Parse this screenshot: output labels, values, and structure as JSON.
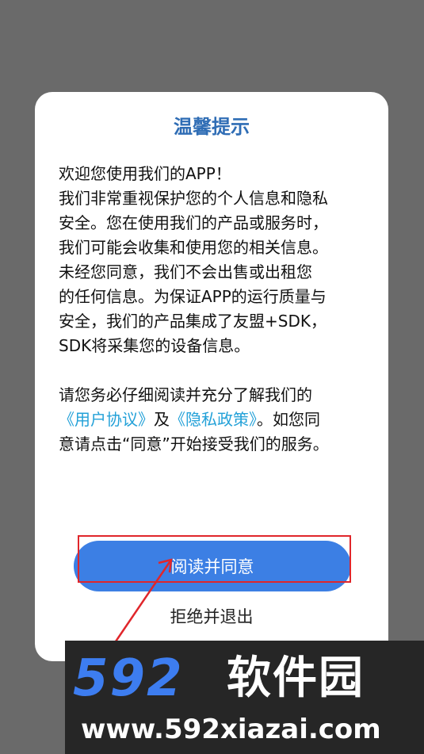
{
  "dialog": {
    "title": "温馨提示",
    "paragraph1": [
      "欢迎您使用我们的APP！",
      "我们非常重视保护您的个人信息和隐私",
      "安全。您在使用我们的产品或服务时，",
      "我们可能会收集和使用您的相关信息。",
      "未经您同意，我们不会出售或出租您",
      "的任何信息。为保证APP的运行质量与",
      "安全，我们的产品集成了友盟+SDK，",
      "SDK将采集您的设备信息。"
    ],
    "paragraph2": {
      "line1": "请您务必仔细阅读并充分了解我们的",
      "user_agreement_link": "《用户协议》",
      "and": "及",
      "privacy_policy_link": "《隐私政策》",
      "line2_tail": "。如您同",
      "line3": "意请点击“同意”开始接受我们的服务。"
    },
    "agree_button": "阅读并同意",
    "decline_button": "拒绝并退出"
  },
  "watermark": {
    "logo_number": "592",
    "logo_text": "软件园",
    "url": "www.592xiazai.com"
  },
  "colors": {
    "title": "#2f6db5",
    "link": "#23a1d8",
    "button": "#3c7fe4",
    "annotation": "#e0262b"
  }
}
